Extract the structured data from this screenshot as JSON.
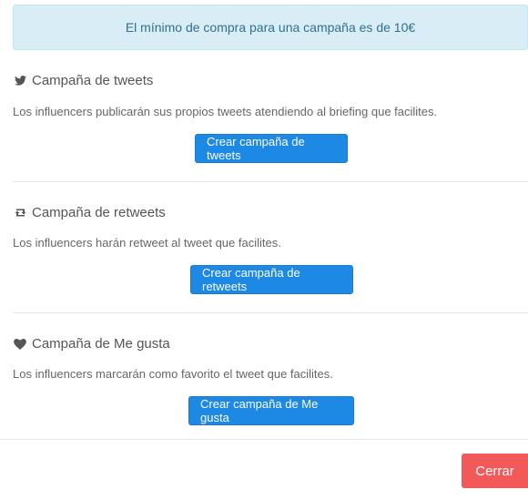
{
  "notice": {
    "text": "El mínimo de compra para una campaña es de 10€"
  },
  "sections": [
    {
      "icon": "twitter-bird-icon",
      "title": "Campaña de tweets",
      "description": "Los influencers publicarán sus propios tweets atendiendo al briefing que facilites.",
      "button": "Crear campaña de tweets"
    },
    {
      "icon": "retweet-icon",
      "title": "Campaña de retweets",
      "description": "Los influencers harán retweet al tweet que facilites.",
      "button": "Crear campaña de retweets"
    },
    {
      "icon": "heart-icon",
      "title": "Campaña de Me gusta",
      "description": "Los influencers marcarán como favorito el tweet que facilites.",
      "button": "Crear campaña de Me gusta"
    }
  ],
  "footer": {
    "close_label": "Cerrar"
  },
  "colors": {
    "accent": "#1e88e5",
    "danger": "#f25a5a",
    "notice_bg": "#d9edf7",
    "notice_text": "#31708f"
  }
}
